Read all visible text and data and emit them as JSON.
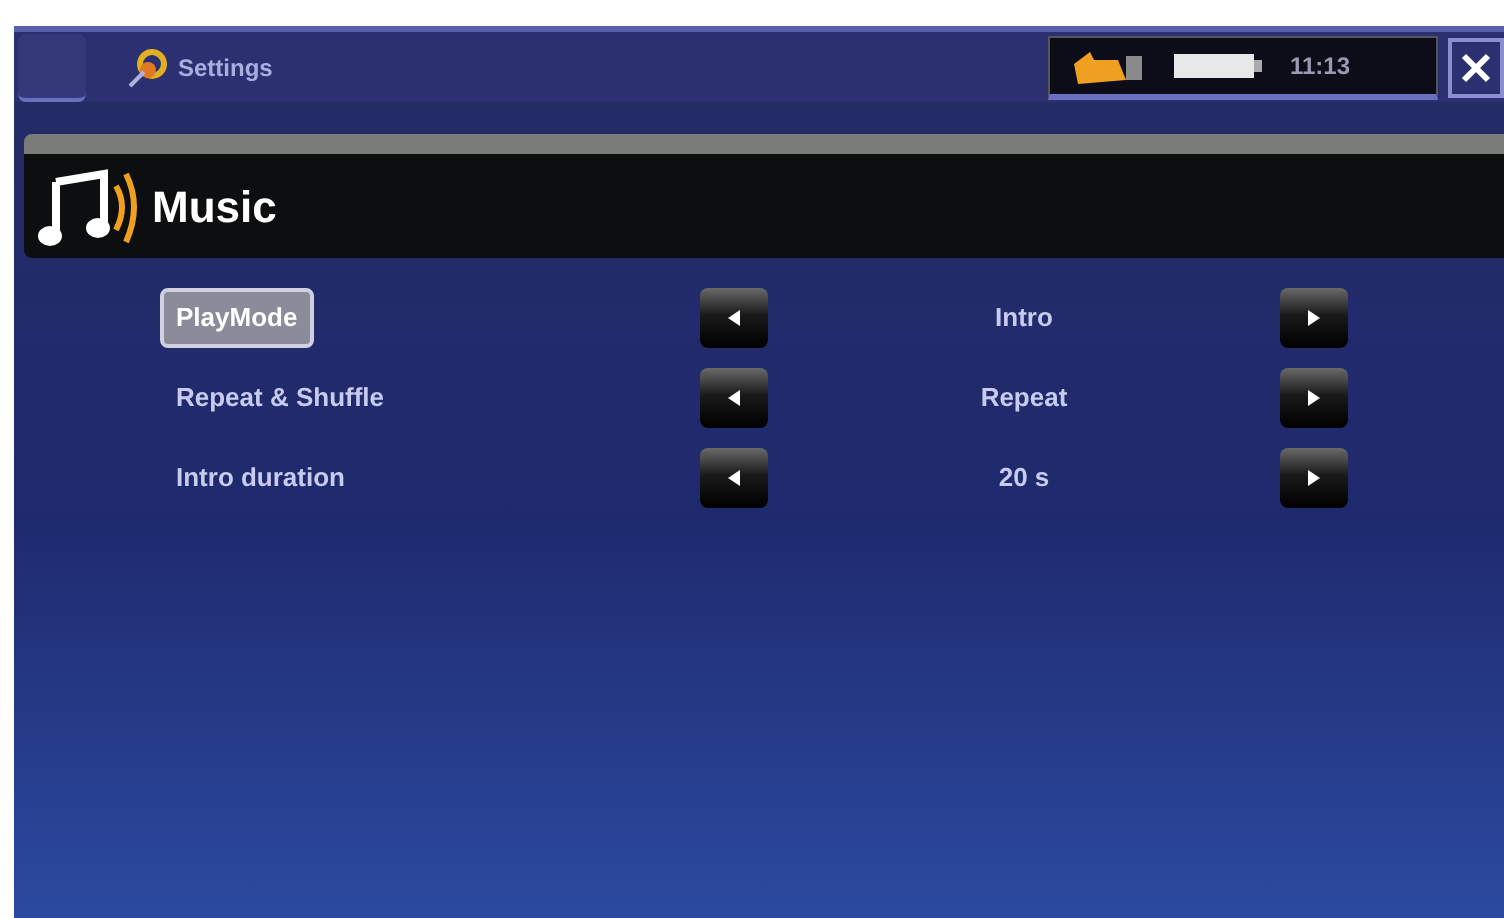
{
  "top_bar": {
    "title": "Settings",
    "clock": "11:13"
  },
  "header": {
    "title": "Music"
  },
  "settings": [
    {
      "label": "PlayMode",
      "value": "Intro",
      "selected": true
    },
    {
      "label": "Repeat & Shuffle",
      "value": "Repeat",
      "selected": false
    },
    {
      "label": "Intro duration",
      "value": "20 s",
      "selected": false
    }
  ]
}
